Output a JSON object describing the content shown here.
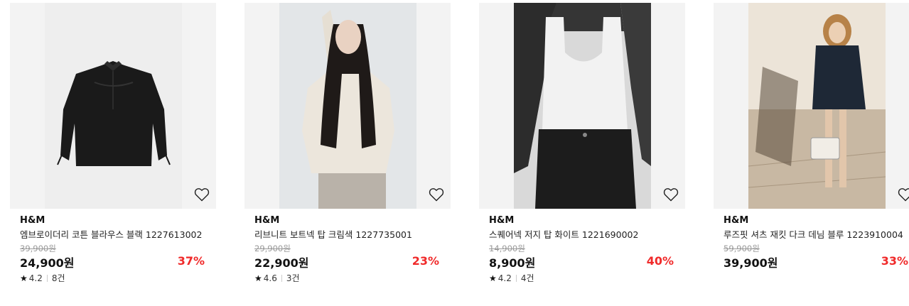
{
  "products": [
    {
      "brand": "H&M",
      "name": "엠브로이더리 코튼 블라우스 블랙 1227613002",
      "original_price": "39,900원",
      "price": "24,900원",
      "discount": "37%",
      "rating": "4.2",
      "review_count": "8건",
      "image_icon": "black-blouse-photo"
    },
    {
      "brand": "H&M",
      "name": "리브니트 보트넥 탑 크림색 1227735001",
      "original_price": "29,900원",
      "price": "22,900원",
      "discount": "23%",
      "rating": "4.6",
      "review_count": "3건",
      "image_icon": "model-cream-knit-photo"
    },
    {
      "brand": "H&M",
      "name": "스퀘어넥 저지 탑 화이트 1221690002",
      "original_price": "14,900원",
      "price": "8,900원",
      "discount": "40%",
      "rating": "4.2",
      "review_count": "4건",
      "image_icon": "model-white-top-photo"
    },
    {
      "brand": "H&M",
      "name": "루즈핏 셔츠 재킷 다크 데님 블루 1223910004",
      "original_price": "59,900원",
      "price": "39,900원",
      "discount": "33%",
      "rating": "",
      "review_count": "",
      "image_icon": "model-denim-jacket-photo"
    }
  ],
  "colors": {
    "discount": "#f02a2a",
    "image_bg": "#f3f3f3"
  },
  "icons": {
    "wishlist": "heart-outline-icon",
    "rating": "star-icon"
  }
}
